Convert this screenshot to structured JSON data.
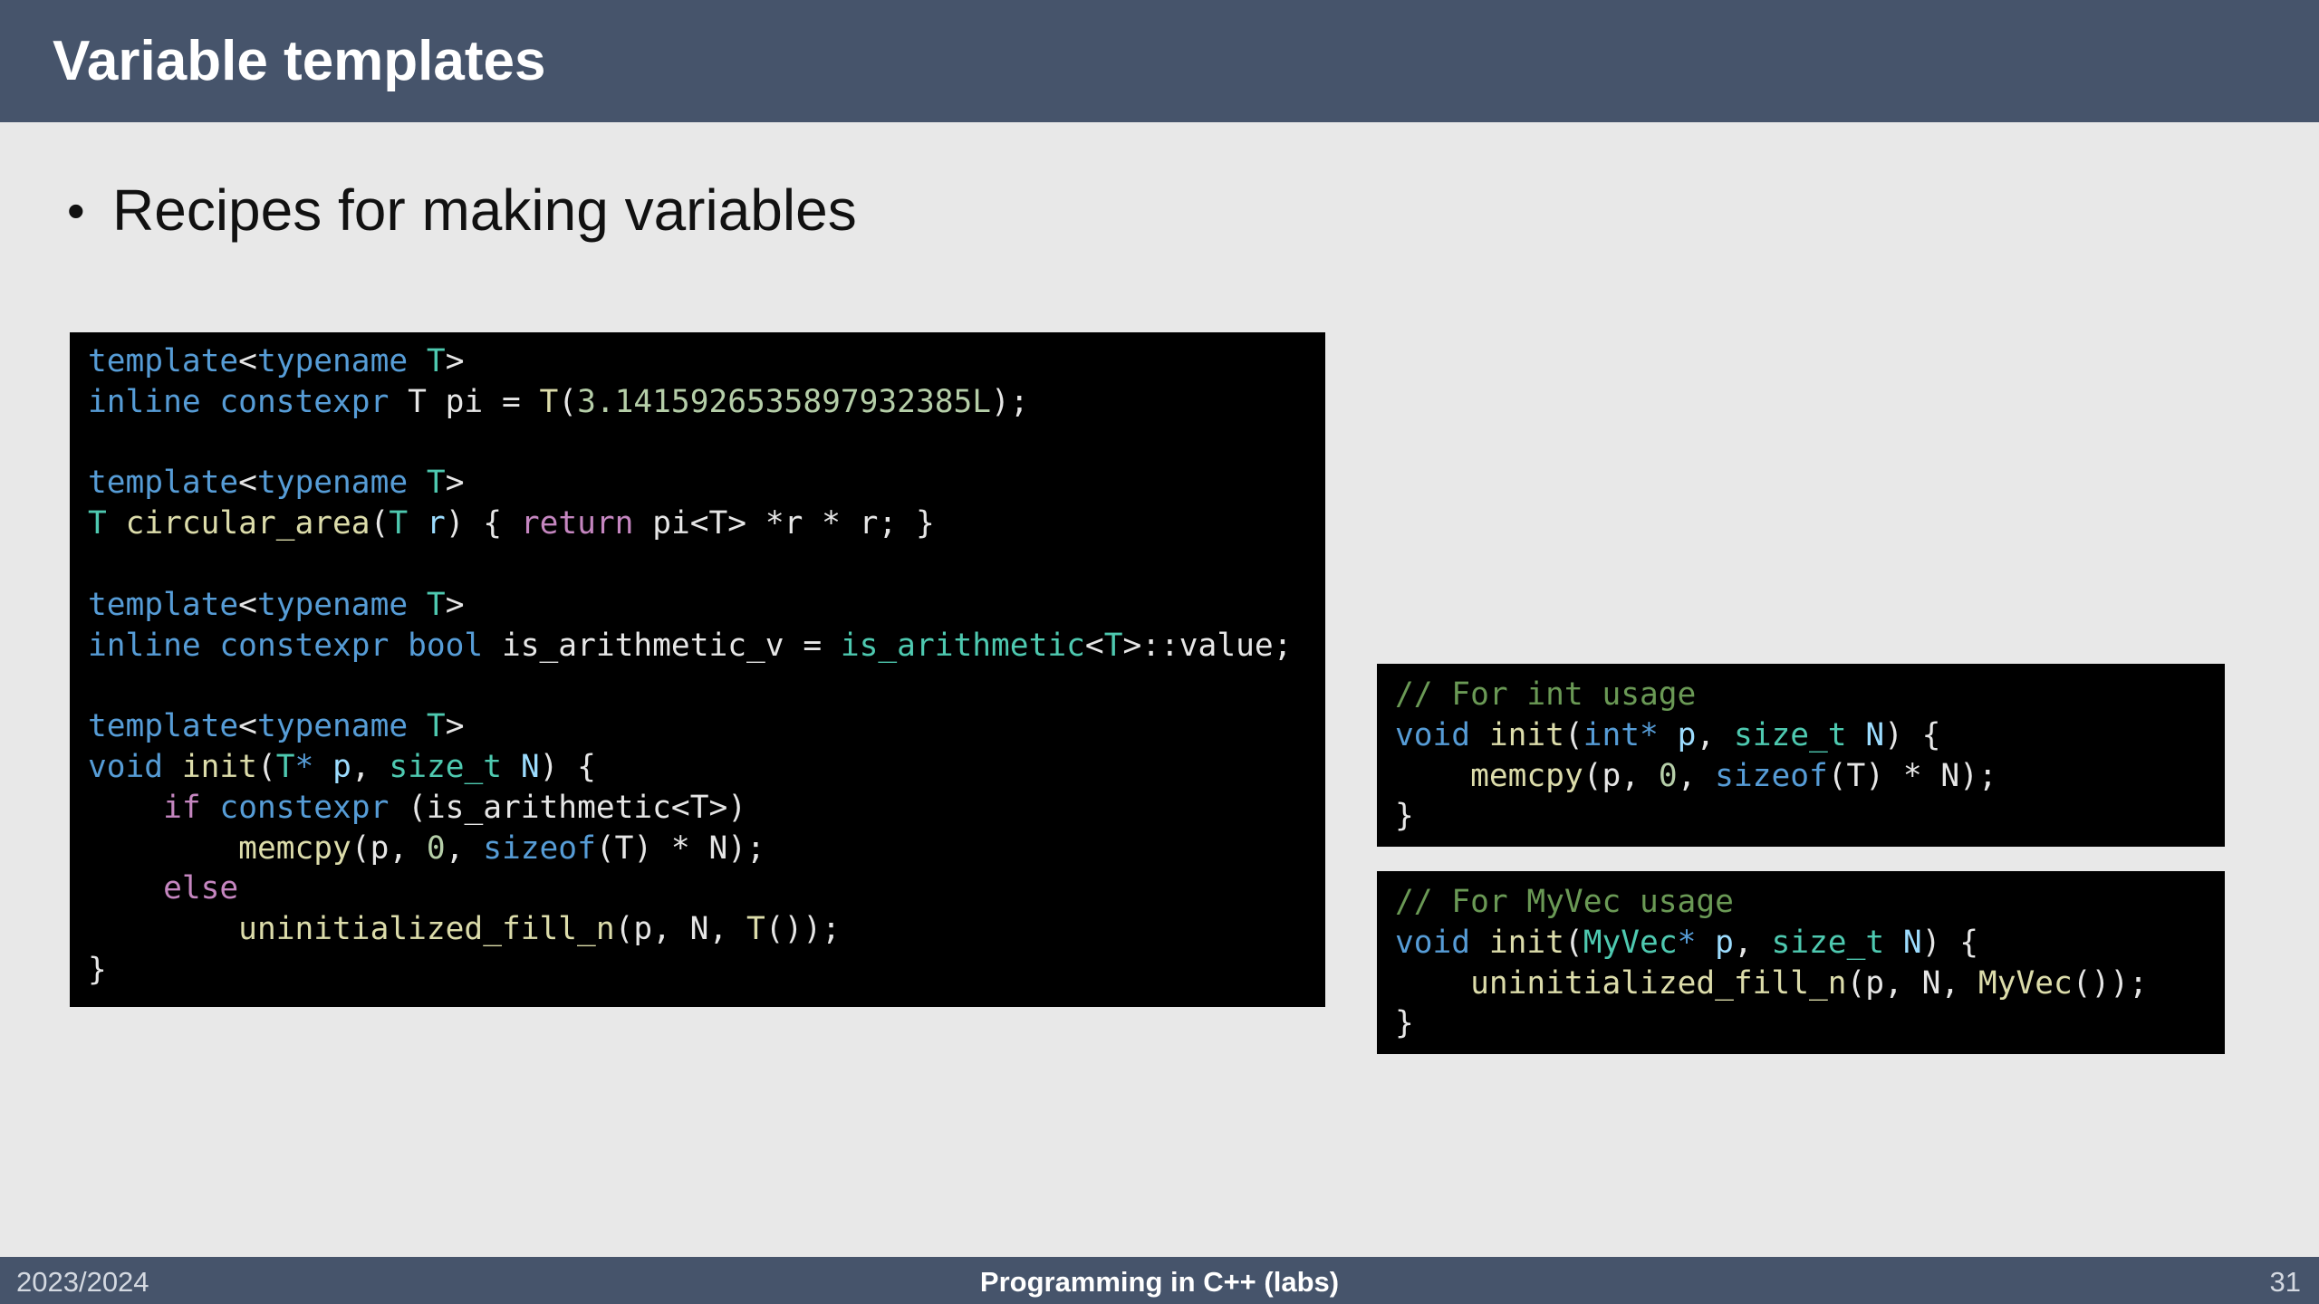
{
  "slide": {
    "title": "Variable templates",
    "bullet": "Recipes for making variables"
  },
  "code_main": [
    [
      [
        "keyword",
        "template"
      ],
      [
        "plain",
        "<"
      ],
      [
        "keyword",
        "typename"
      ],
      [
        "plain",
        " "
      ],
      [
        "type",
        "T"
      ],
      [
        "plain",
        ">"
      ]
    ],
    [
      [
        "keyword",
        "inline"
      ],
      [
        "plain",
        " "
      ],
      [
        "keyword",
        "constexpr"
      ],
      [
        "plain",
        " T pi = "
      ],
      [
        "func",
        "T"
      ],
      [
        "plain",
        "("
      ],
      [
        "number",
        "3.1415926535897932385L"
      ],
      [
        "plain",
        ");"
      ]
    ],
    [],
    [
      [
        "keyword",
        "template"
      ],
      [
        "plain",
        "<"
      ],
      [
        "keyword",
        "typename"
      ],
      [
        "plain",
        " "
      ],
      [
        "type",
        "T"
      ],
      [
        "plain",
        ">"
      ]
    ],
    [
      [
        "type",
        "T"
      ],
      [
        "plain",
        " "
      ],
      [
        "func",
        "circular_area"
      ],
      [
        "plain",
        "("
      ],
      [
        "type",
        "T"
      ],
      [
        "plain",
        " "
      ],
      [
        "param",
        "r"
      ],
      [
        "plain",
        ") { "
      ],
      [
        "control",
        "return"
      ],
      [
        "plain",
        " pi<T> *r * r; }"
      ]
    ],
    [],
    [
      [
        "keyword",
        "template"
      ],
      [
        "plain",
        "<"
      ],
      [
        "keyword",
        "typename"
      ],
      [
        "plain",
        " "
      ],
      [
        "type",
        "T"
      ],
      [
        "plain",
        ">"
      ]
    ],
    [
      [
        "keyword",
        "inline"
      ],
      [
        "plain",
        " "
      ],
      [
        "keyword",
        "constexpr"
      ],
      [
        "plain",
        " "
      ],
      [
        "keyword",
        "bool"
      ],
      [
        "plain",
        " is_arithmetic_v = "
      ],
      [
        "type",
        "is_arithmetic"
      ],
      [
        "plain",
        "<"
      ],
      [
        "type",
        "T"
      ],
      [
        "plain",
        ">::value;"
      ]
    ],
    [],
    [
      [
        "keyword",
        "template"
      ],
      [
        "plain",
        "<"
      ],
      [
        "keyword",
        "typename"
      ],
      [
        "plain",
        " "
      ],
      [
        "type",
        "T"
      ],
      [
        "plain",
        ">"
      ]
    ],
    [
      [
        "keyword",
        "void"
      ],
      [
        "plain",
        " "
      ],
      [
        "func",
        "init"
      ],
      [
        "plain",
        "("
      ],
      [
        "type",
        "T"
      ],
      [
        "keyword",
        "*"
      ],
      [
        "plain",
        " "
      ],
      [
        "param",
        "p"
      ],
      [
        "plain",
        ", "
      ],
      [
        "type",
        "size_t"
      ],
      [
        "plain",
        " "
      ],
      [
        "param",
        "N"
      ],
      [
        "plain",
        ") {"
      ]
    ],
    [
      [
        "plain",
        "    "
      ],
      [
        "control",
        "if"
      ],
      [
        "plain",
        " "
      ],
      [
        "keyword",
        "constexpr"
      ],
      [
        "plain",
        " (is_arithmetic<T>)"
      ]
    ],
    [
      [
        "plain",
        "        "
      ],
      [
        "func",
        "memcpy"
      ],
      [
        "plain",
        "(p, "
      ],
      [
        "number",
        "0"
      ],
      [
        "plain",
        ", "
      ],
      [
        "keyword",
        "sizeof"
      ],
      [
        "plain",
        "(T) * N);"
      ]
    ],
    [
      [
        "plain",
        "    "
      ],
      [
        "control",
        "else"
      ]
    ],
    [
      [
        "plain",
        "        "
      ],
      [
        "func",
        "uninitialized_fill_n"
      ],
      [
        "plain",
        "(p, N, "
      ],
      [
        "func",
        "T"
      ],
      [
        "plain",
        "());"
      ]
    ],
    [
      [
        "plain",
        "}"
      ]
    ]
  ],
  "code_int": [
    [
      [
        "comment",
        "// For int usage"
      ]
    ],
    [
      [
        "keyword",
        "void"
      ],
      [
        "plain",
        " "
      ],
      [
        "func",
        "init"
      ],
      [
        "plain",
        "("
      ],
      [
        "keyword",
        "int*"
      ],
      [
        "plain",
        " "
      ],
      [
        "param",
        "p"
      ],
      [
        "plain",
        ", "
      ],
      [
        "type",
        "size_t"
      ],
      [
        "plain",
        " "
      ],
      [
        "param",
        "N"
      ],
      [
        "plain",
        ") {"
      ]
    ],
    [
      [
        "plain",
        "    "
      ],
      [
        "func",
        "memcpy"
      ],
      [
        "plain",
        "(p, "
      ],
      [
        "number",
        "0"
      ],
      [
        "plain",
        ", "
      ],
      [
        "keyword",
        "sizeof"
      ],
      [
        "plain",
        "(T) * N);"
      ]
    ],
    [
      [
        "plain",
        "}"
      ]
    ]
  ],
  "code_vec": [
    [
      [
        "comment",
        "// For MyVec usage"
      ]
    ],
    [
      [
        "keyword",
        "void"
      ],
      [
        "plain",
        " "
      ],
      [
        "func",
        "init"
      ],
      [
        "plain",
        "("
      ],
      [
        "type",
        "MyVec"
      ],
      [
        "keyword",
        "*"
      ],
      [
        "plain",
        " "
      ],
      [
        "param",
        "p"
      ],
      [
        "plain",
        ", "
      ],
      [
        "type",
        "size_t"
      ],
      [
        "plain",
        " "
      ],
      [
        "param",
        "N"
      ],
      [
        "plain",
        ") {"
      ]
    ],
    [
      [
        "plain",
        "    "
      ],
      [
        "func",
        "uninitialized_fill_n"
      ],
      [
        "plain",
        "(p, N, "
      ],
      [
        "func",
        "MyVec"
      ],
      [
        "plain",
        "());"
      ]
    ],
    [
      [
        "plain",
        "}"
      ]
    ]
  ],
  "footer": {
    "left": "2023/2024",
    "center": "Programming in C++ (labs)",
    "right": "31"
  }
}
